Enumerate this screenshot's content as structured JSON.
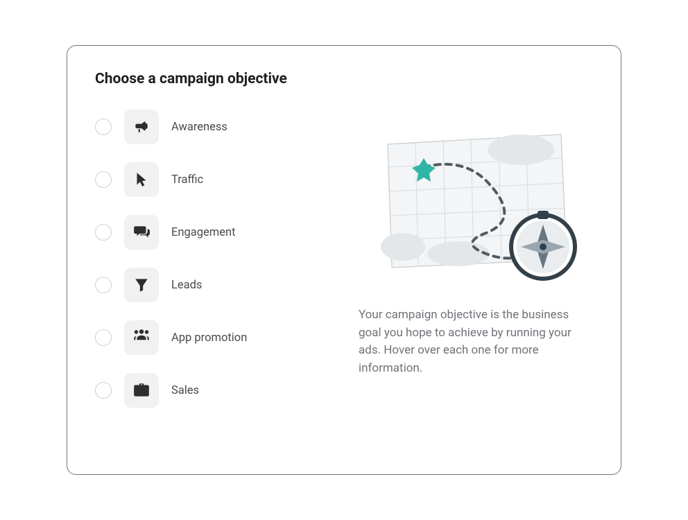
{
  "title": "Choose a campaign objective",
  "options": [
    {
      "label": "Awareness"
    },
    {
      "label": "Traffic"
    },
    {
      "label": "Engagement"
    },
    {
      "label": "Leads"
    },
    {
      "label": "App promotion"
    },
    {
      "label": "Sales"
    }
  ],
  "info_text": "Your campaign objective is the business goal you hope to achieve by running your ads. Hover over each one for more information."
}
